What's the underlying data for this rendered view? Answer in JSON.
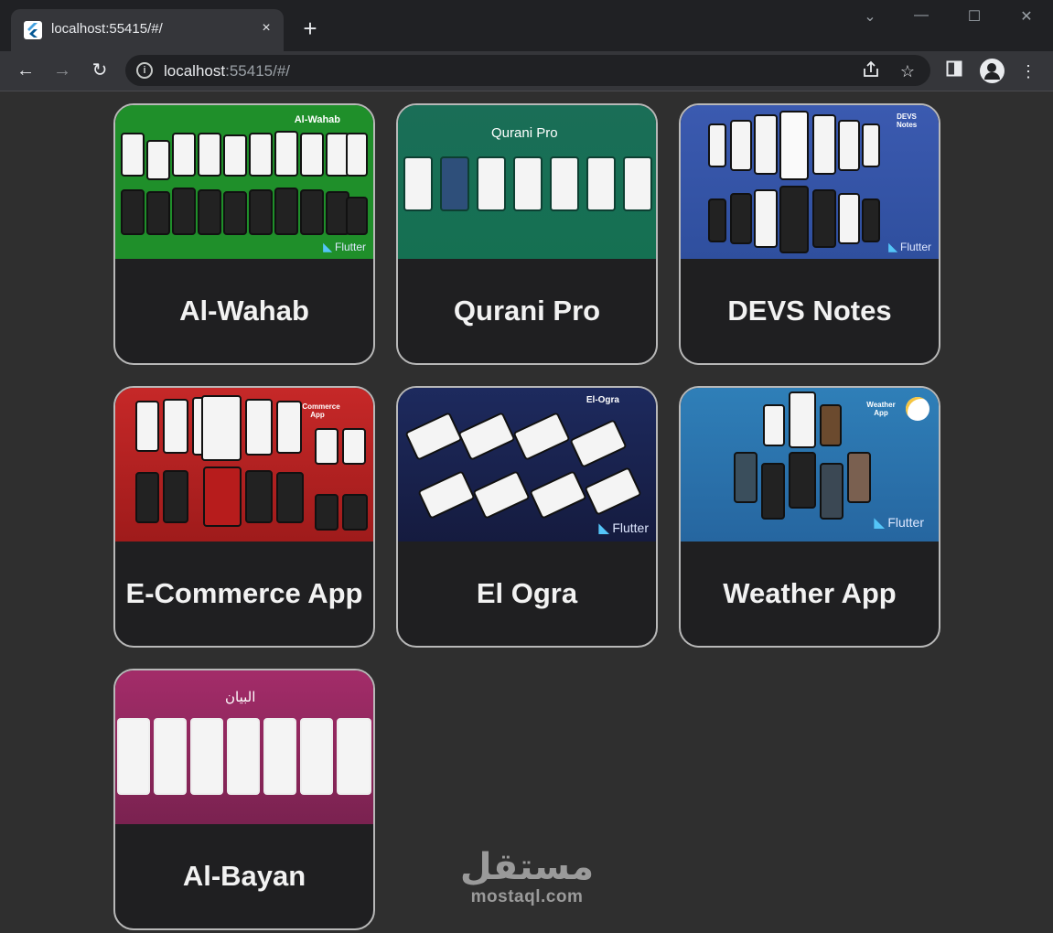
{
  "browser": {
    "tab_title": "localhost:55415/#/",
    "tab_close": "×",
    "new_tab": "+",
    "url_host": "localhost",
    "url_rest": ":55415/#/",
    "window_controls": {
      "dropdown": "⌄",
      "minimize": "—",
      "maximize": "☐",
      "close": "✕"
    },
    "nav": {
      "back": "←",
      "forward": "→",
      "reload": "↻"
    },
    "icons": {
      "share": "share-icon",
      "star": "star-icon",
      "sidepanel": "side-panel-icon",
      "profile": "profile-icon",
      "menu": "menu-icon"
    }
  },
  "projects": [
    {
      "title": "Al-Wahab",
      "image_caption": "Al-Wahab",
      "bg": "#1f8f2a",
      "flutter": "Flutter"
    },
    {
      "title": "Qurani Pro",
      "image_caption": "Qurani Pro",
      "bg": "#1a6e57",
      "flutter": ""
    },
    {
      "title": "DEVS Notes",
      "image_caption": "DEVS Notes",
      "bg": "#3a56a8",
      "flutter": "Flutter"
    },
    {
      "title": "E-Commerce App",
      "image_caption": "E-Commerce App",
      "bg": "#b31f1f",
      "flutter": ""
    },
    {
      "title": "El Ogra",
      "image_caption": "El-Ogra",
      "bg": "#1b2452",
      "flutter": "Flutter"
    },
    {
      "title": "Weather App",
      "image_caption": "Weather App",
      "bg": "#2a74ab",
      "flutter": "Flutter"
    },
    {
      "title": "Al-Bayan",
      "image_caption": "البيان",
      "bg": "#8e2a5c",
      "flutter": ""
    }
  ],
  "watermark": {
    "arabic": "مستقل",
    "latin": "mostaql.com"
  }
}
